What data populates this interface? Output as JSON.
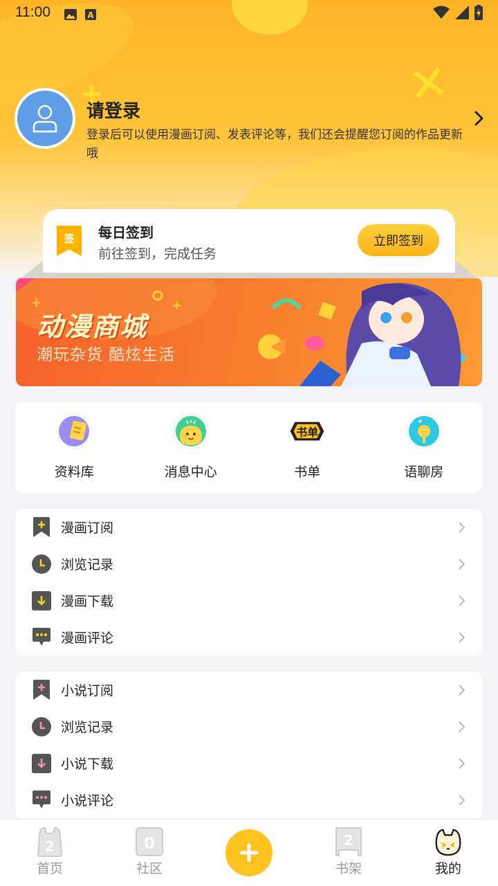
{
  "status_bar": {
    "time": "11:00"
  },
  "login": {
    "title": "请登录",
    "description": "登录后可以使用漫画订阅、发表评论等，我们还会提醒您订阅的作品更新哦"
  },
  "checkin": {
    "badge": "签",
    "title": "每日签到",
    "subtitle": "前往签到，完成任务",
    "button": "立即签到"
  },
  "banner": {
    "title": "动漫商城",
    "subtitle": "潮玩杂货 酷炫生活"
  },
  "quick_links": [
    {
      "label": "资料库",
      "icon": "archive-icon"
    },
    {
      "label": "消息中心",
      "icon": "message-center-icon"
    },
    {
      "label": "书单",
      "icon": "booklist-icon",
      "icon_text": "书单"
    },
    {
      "label": "语聊房",
      "icon": "voice-room-icon"
    }
  ],
  "comic_menu": [
    {
      "label": "漫画订阅",
      "icon": "bookmark-plus-icon"
    },
    {
      "label": "浏览记录",
      "icon": "clock-icon"
    },
    {
      "label": "漫画下载",
      "icon": "download-icon"
    },
    {
      "label": "漫画评论",
      "icon": "comment-icon"
    }
  ],
  "novel_menu": [
    {
      "label": "小说订阅",
      "icon": "bookmark-plus-icon"
    },
    {
      "label": "浏览记录",
      "icon": "clock-icon"
    },
    {
      "label": "小说下载",
      "icon": "download-icon"
    },
    {
      "label": "小说评论",
      "icon": "comment-icon"
    }
  ],
  "bottom_nav": [
    {
      "label": "首页",
      "icon": "home-icon"
    },
    {
      "label": "社区",
      "icon": "community-icon"
    },
    {
      "label": "",
      "icon": "add-icon"
    },
    {
      "label": "书架",
      "icon": "bookshelf-icon"
    },
    {
      "label": "我的",
      "icon": "profile-icon",
      "active": true
    }
  ],
  "colors": {
    "accent": "#ffc21e",
    "comic_icon_accent": "#ffd21e",
    "novel_icon_accent": "#ff8fb0",
    "avatar_bg": "#5f9de6"
  }
}
